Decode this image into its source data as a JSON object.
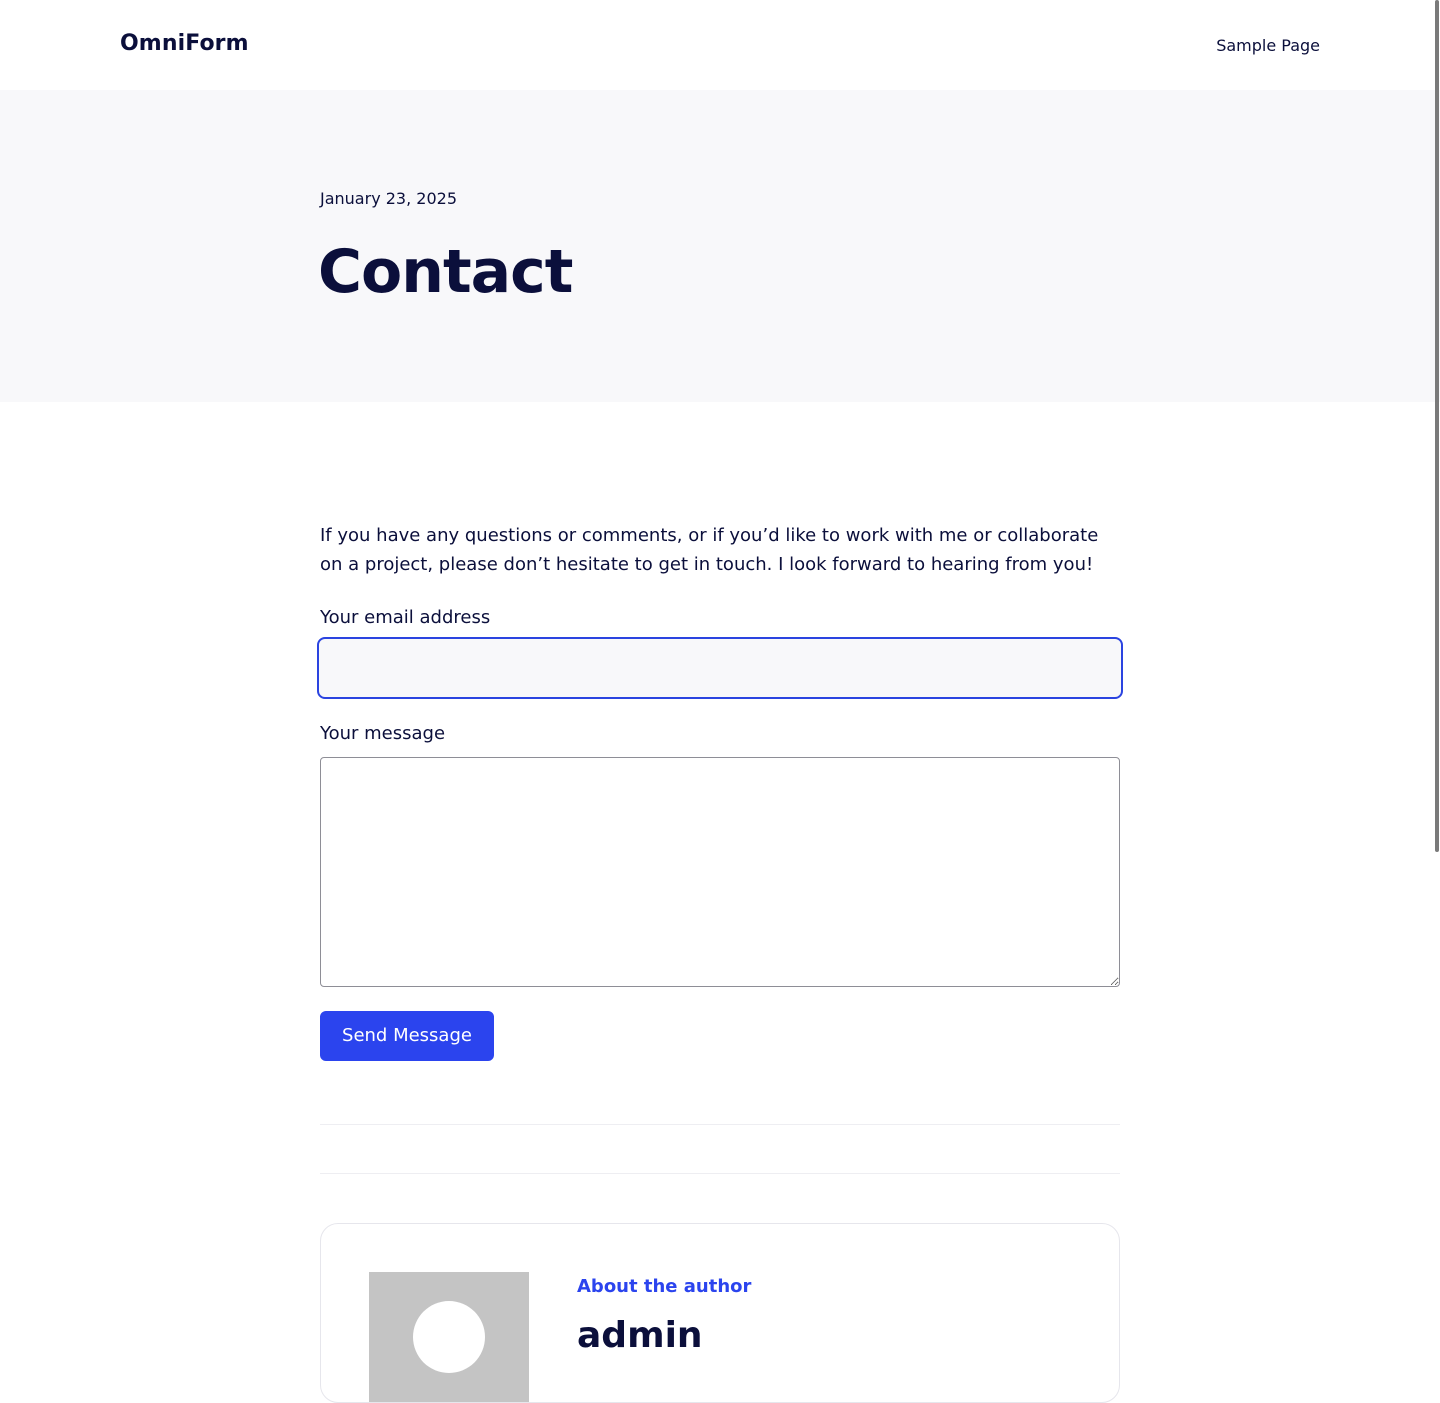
{
  "header": {
    "site_title": "OmniForm",
    "nav": [
      {
        "label": "Sample Page"
      }
    ]
  },
  "hero": {
    "date": "January 23, 2025",
    "title": "Contact"
  },
  "content": {
    "intro": "If you have any questions or comments, or if you’d like to work with me or collaborate on a project, please don’t hesitate to get in touch. I look forward to hearing from you!"
  },
  "form": {
    "email_label": "Your email address",
    "email_value": "",
    "message_label": "Your message",
    "message_value": "",
    "submit_label": "Send Message"
  },
  "author": {
    "kicker": "About the author",
    "name": "admin"
  },
  "colors": {
    "accent": "#2b44ee",
    "text": "#0b0f3b",
    "hero_bg": "#f8f8fa"
  }
}
